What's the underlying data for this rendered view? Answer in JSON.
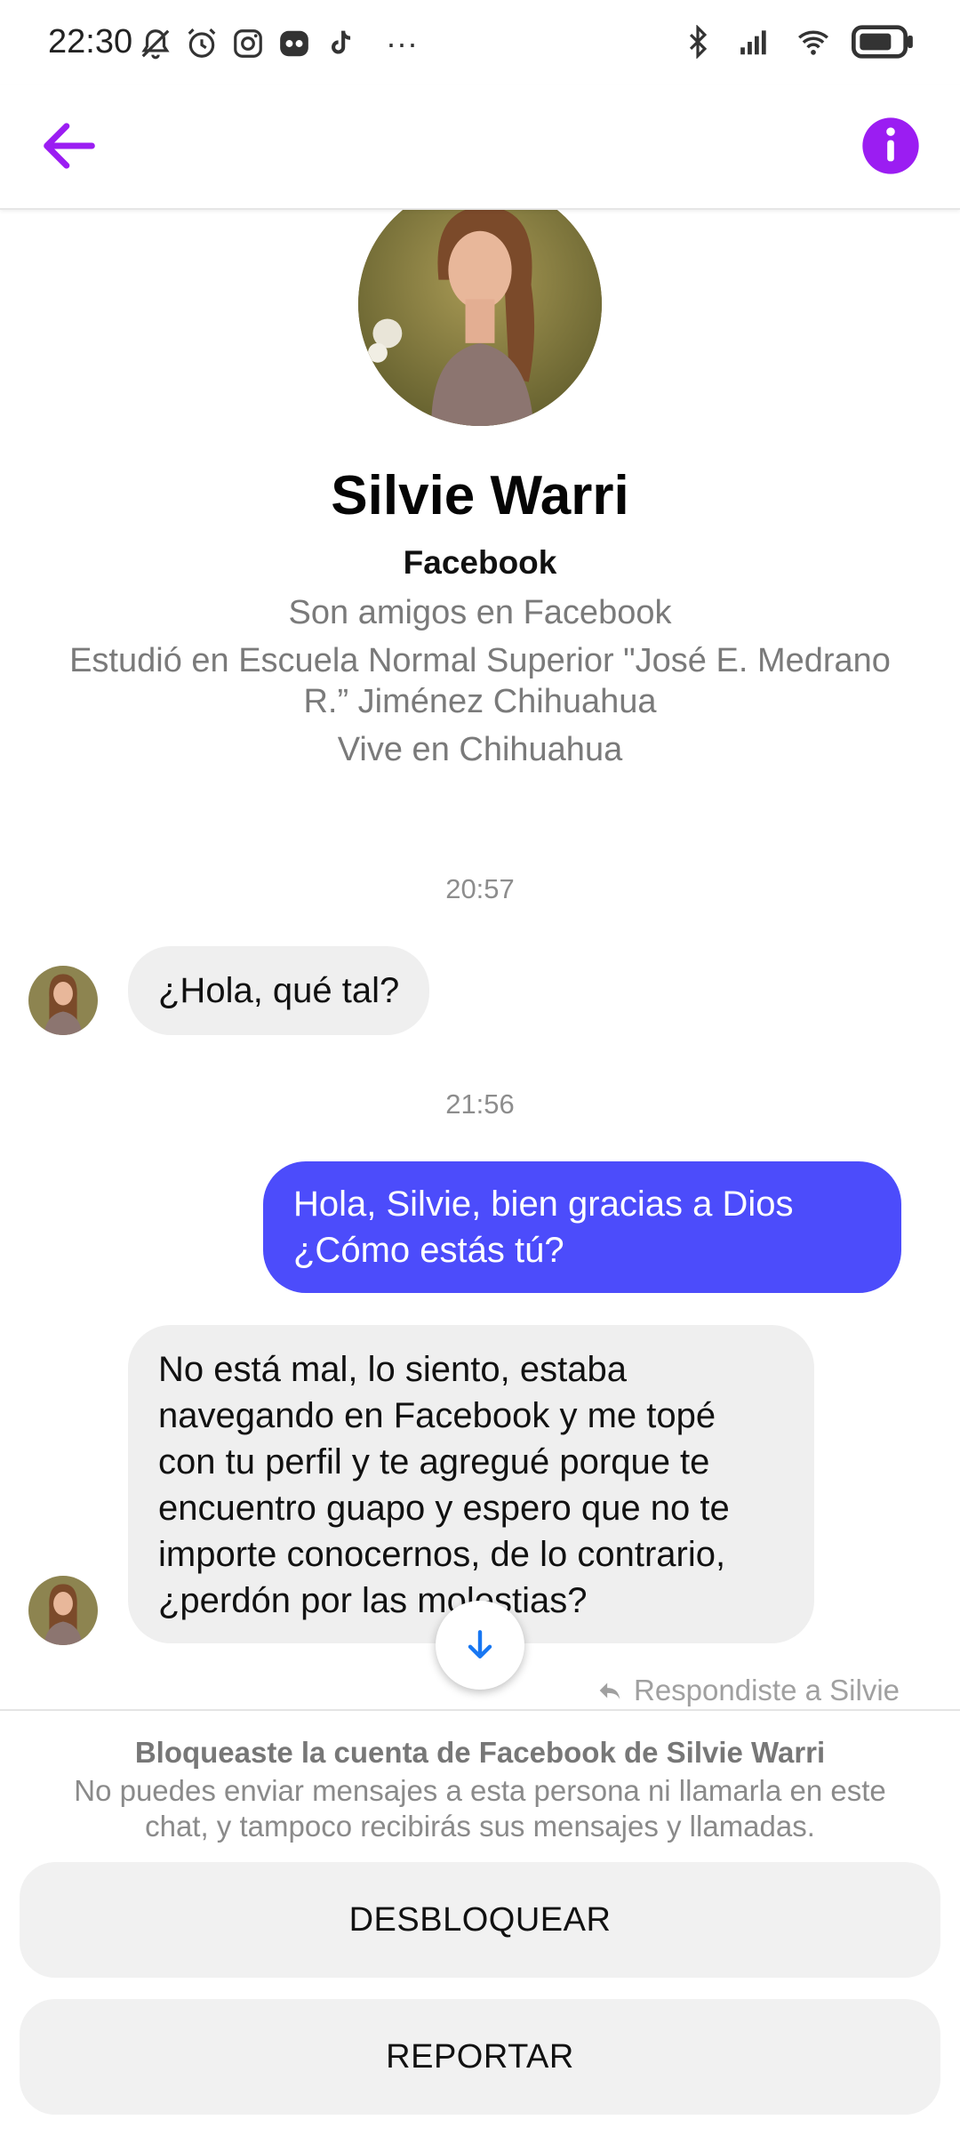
{
  "status_bar": {
    "time": "22:30",
    "more": "···",
    "left_icons": [
      "bell-off-icon",
      "alarm-icon",
      "instagram-icon",
      "app-icon",
      "tiktok-icon"
    ],
    "right_icons": [
      "bluetooth-icon",
      "signal-icon",
      "wifi-icon",
      "battery-icon"
    ]
  },
  "header": {
    "back_icon": "arrow-left-icon",
    "info_icon": "info-icon",
    "accent_color": "#9b1df2"
  },
  "profile": {
    "name": "Silvie Warri",
    "source": "Facebook",
    "friends": "Son amigos en Facebook",
    "studied_line1": "Estudió en Escuela Normal Superior \"José E. Medrano",
    "studied_line2": "R.” Jiménez Chihuahua",
    "lives": "Vive en Chihuahua"
  },
  "messages": {
    "time1": "20:57",
    "msg1": "¿Hola, qué tal?",
    "time2": "21:56",
    "msg2_line1": "Hola, Silvie, bien gracias a Dios",
    "msg2_line2": "¿Cómo estás tú?",
    "msg3_lines": [
      "No está mal, lo siento, estaba",
      "navegando en Facebook y me topé",
      "con tu perfil y te agregué porque te",
      "encuentro guapo y espero que no te",
      "importe conocernos, de lo contrario,",
      "¿perdón por las molestias?"
    ],
    "replied_label": "Respondiste a Silvie",
    "outgoing_color": "#4c4cfb"
  },
  "block_notice": {
    "title": "Bloqueaste la cuenta de Facebook de Silvie Warri",
    "desc_line1": "No puedes enviar mensajes a esta persona ni llamarla en este",
    "desc_line2": "chat, y tampoco recibirás sus mensajes y llamadas.",
    "unblock_label": "DESBLOQUEAR",
    "report_label": "REPORTAR"
  }
}
